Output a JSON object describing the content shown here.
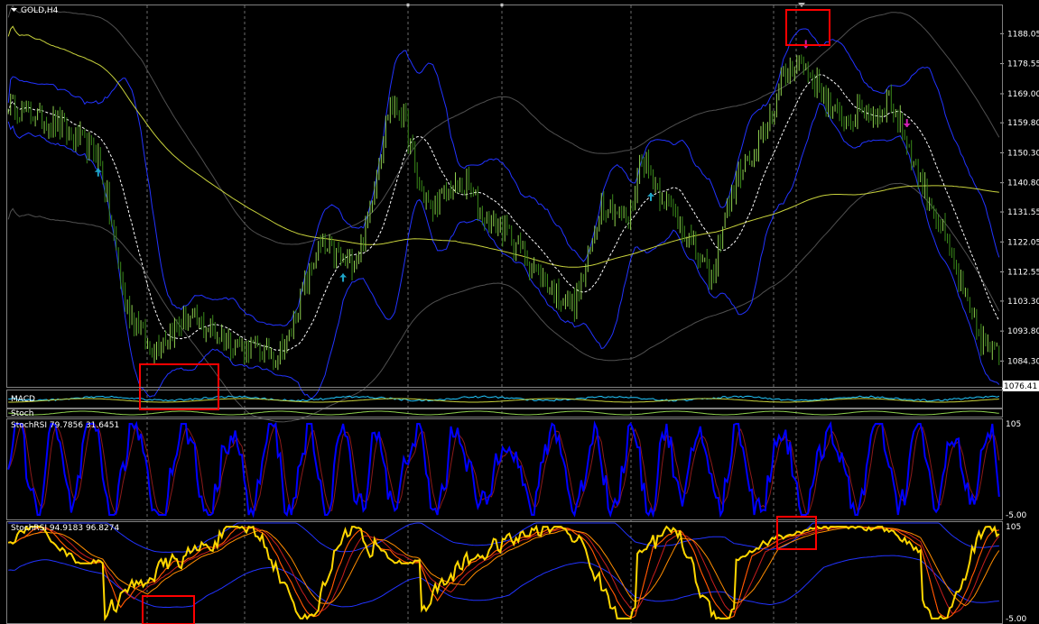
{
  "chart_data": [
    {
      "type": "candlestick",
      "title": "GOLD,H4",
      "y_ticks": [
        "1188.05",
        "1178.55",
        "1169.00",
        "1159.80",
        "1150.30",
        "1140.80",
        "1131.55",
        "1122.05",
        "1112.55",
        "1103.30",
        "1093.80",
        "1084.30"
      ],
      "current_price": "1076.41",
      "ylim": [
        1076.41,
        1197.0
      ],
      "grid": "vertical-dashed",
      "buy_signals": [
        40,
        149,
        286
      ],
      "sell_signals": [
        355,
        400
      ]
    },
    {
      "type": "line",
      "title": "MACD",
      "partially_hidden": true
    },
    {
      "type": "line",
      "title": "Stoch",
      "partially_hidden": true
    },
    {
      "type": "line",
      "title": "StochRSI 79.7856 31.6451",
      "y_ticks": [
        "105",
        "-5.00"
      ],
      "ylim": [
        -5,
        105
      ],
      "series": [
        {
          "name": "StochRSI",
          "color": "#0000ff"
        },
        {
          "name": "Signal",
          "color": "#8b1a1a"
        }
      ]
    },
    {
      "type": "line",
      "title": "StochRSI 94.9183 96.8274",
      "y_ticks": [
        "105",
        "-5.00"
      ],
      "ylim": [
        -5,
        105
      ],
      "series": [
        {
          "name": "StochRSI",
          "color": "#ffd700"
        },
        {
          "name": "Signal",
          "color": "#ff5a00"
        }
      ]
    }
  ],
  "colors": {
    "bull_candle": "#8fd14f",
    "bear_candle": "#3a8a1a",
    "bollinger": "#2233ff",
    "ma_long": "#c8d23c",
    "ma_mid": "#ffffff",
    "envelope": "#505050",
    "buy_arrow": "#1fa5c8",
    "sell_arrow": "#d21fb4",
    "highlight": "#ff0000"
  }
}
